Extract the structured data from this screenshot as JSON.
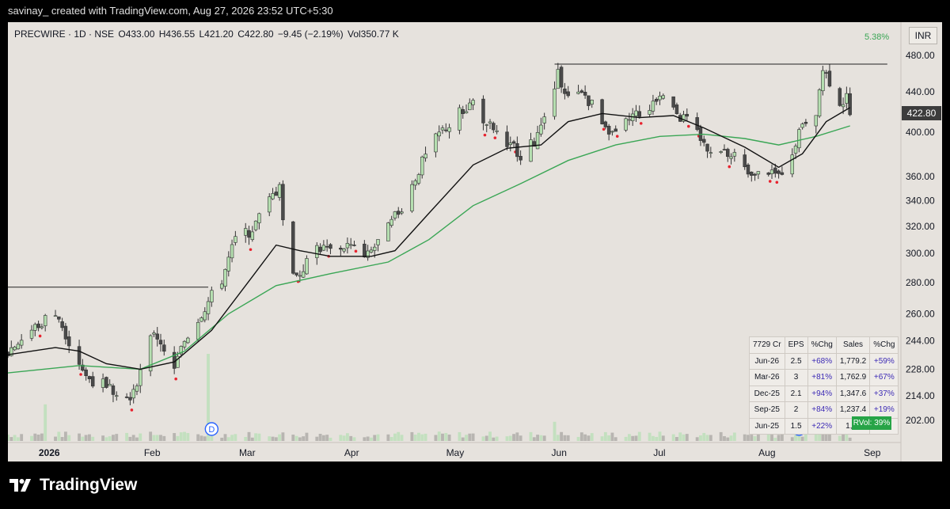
{
  "header": {
    "text": "savinay_ created with TradingView.com, Aug 27, 2026 23:52 UTC+5:30"
  },
  "legend": {
    "symbol": "PRECWIRE · 1D · NSE",
    "open": "O433.00",
    "high": "H436.55",
    "low": "L421.20",
    "close": "C422.80",
    "change": "−9.45 (−2.19%)",
    "volume": "Vol350.77 K"
  },
  "scale": {
    "currency": "INR",
    "percent_label": "5.38%",
    "last_price": "422.80"
  },
  "fundamentals": {
    "header": [
      "7729 Cr",
      "EPS",
      "%Chg",
      "Sales",
      "%Chg"
    ],
    "rows": [
      [
        "Jun-26",
        "2.5",
        "+68%",
        "1,779.2",
        "+59%"
      ],
      [
        "Mar-26",
        "3",
        "+81%",
        "1,762.9",
        "+67%"
      ],
      [
        "Dec-25",
        "2.1",
        "+94%",
        "1,347.6",
        "+37%"
      ],
      [
        "Sep-25",
        "2",
        "+84%",
        "1,237.4",
        "+19%"
      ],
      [
        "Jun-25",
        "1.5",
        "+22%",
        "1,11",
        ""
      ]
    ],
    "rvol": "RVol: 39%"
  },
  "brand": {
    "name": "TradingView"
  },
  "colors": {
    "up": "#b5dfb0",
    "down": "#4a4a4a",
    "ma_short": "#111111",
    "ma_long": "#3aa655",
    "marker": "#e8232f",
    "background": "#e6e2dd"
  },
  "icons": [
    "dividend-icon",
    "tradingview-logo-icon"
  ],
  "chart_data": {
    "type": "candlestick",
    "scale": "log",
    "ylim": [
      192,
      500
    ],
    "yticks": [
      202,
      214,
      228,
      244,
      260,
      280,
      300,
      320,
      340,
      360,
      400,
      440,
      480
    ],
    "xticks": [
      {
        "label": "2026",
        "date": "2026-01-01"
      },
      {
        "label": "Feb",
        "date": "2026-02-01"
      },
      {
        "label": "Mar",
        "date": "2026-03-01"
      },
      {
        "label": "Apr",
        "date": "2026-04-01"
      },
      {
        "label": "May",
        "date": "2026-05-01"
      },
      {
        "label": "Jun",
        "date": "2026-06-01"
      },
      {
        "label": "Jul",
        "date": "2026-07-01"
      },
      {
        "label": "Aug",
        "date": "2026-08-01"
      },
      {
        "label": "Sep",
        "date": "2026-09-01"
      }
    ],
    "xrange": [
      "2025-12-22",
      "2026-09-11"
    ],
    "close_path": [
      [
        "2025-12-22",
        238
      ],
      [
        "2025-12-29",
        250
      ],
      [
        "2026-01-05",
        262
      ],
      [
        "2026-01-09",
        244
      ],
      [
        "2026-01-14",
        224
      ],
      [
        "2026-01-20",
        219
      ],
      [
        "2026-01-27",
        215
      ],
      [
        "2026-01-30",
        226
      ],
      [
        "2026-02-03",
        250
      ],
      [
        "2026-02-06",
        240
      ],
      [
        "2026-02-09",
        228
      ],
      [
        "2026-02-12",
        244
      ],
      [
        "2026-02-18",
        264
      ],
      [
        "2026-02-23",
        282
      ],
      [
        "2026-02-27",
        310
      ],
      [
        "2026-03-04",
        318
      ],
      [
        "2026-03-09",
        340
      ],
      [
        "2026-03-12",
        352
      ],
      [
        "2026-03-14",
        290
      ],
      [
        "2026-03-18",
        286
      ],
      [
        "2026-03-23",
        305
      ],
      [
        "2026-03-27",
        302
      ],
      [
        "2026-04-01",
        306
      ],
      [
        "2026-04-07",
        298
      ],
      [
        "2026-04-13",
        318
      ],
      [
        "2026-04-18",
        340
      ],
      [
        "2026-04-23",
        372
      ],
      [
        "2026-04-28",
        398
      ],
      [
        "2026-05-04",
        418
      ],
      [
        "2026-05-08",
        430
      ],
      [
        "2026-05-12",
        408
      ],
      [
        "2026-05-18",
        392
      ],
      [
        "2026-05-22",
        380
      ],
      [
        "2026-05-26",
        390
      ],
      [
        "2026-05-29",
        412
      ],
      [
        "2026-06-02",
        458
      ],
      [
        "2026-06-05",
        438
      ],
      [
        "2026-06-10",
        436
      ],
      [
        "2026-06-15",
        412
      ],
      [
        "2026-06-19",
        396
      ],
      [
        "2026-06-24",
        416
      ],
      [
        "2026-06-29",
        425
      ],
      [
        "2026-07-02",
        440
      ],
      [
        "2026-07-06",
        420
      ],
      [
        "2026-07-10",
        410
      ],
      [
        "2026-07-15",
        388
      ],
      [
        "2026-07-20",
        382
      ],
      [
        "2026-07-24",
        376
      ],
      [
        "2026-07-29",
        358
      ],
      [
        "2026-08-03",
        366
      ],
      [
        "2026-08-06",
        360
      ],
      [
        "2026-08-10",
        384
      ],
      [
        "2026-08-13",
        410
      ],
      [
        "2026-08-17",
        420
      ],
      [
        "2026-08-19",
        464
      ],
      [
        "2026-08-21",
        452
      ],
      [
        "2026-08-24",
        430
      ],
      [
        "2026-08-26",
        432
      ],
      [
        "2026-08-27",
        422.8
      ]
    ],
    "ma_short": [
      [
        "2025-12-22",
        236
      ],
      [
        "2026-01-05",
        240
      ],
      [
        "2026-01-12",
        238
      ],
      [
        "2026-01-20",
        231
      ],
      [
        "2026-01-30",
        228
      ],
      [
        "2026-02-09",
        232
      ],
      [
        "2026-02-20",
        250
      ],
      [
        "2026-03-04",
        284
      ],
      [
        "2026-03-11",
        306
      ],
      [
        "2026-03-18",
        302
      ],
      [
        "2026-03-27",
        298
      ],
      [
        "2026-04-08",
        298
      ],
      [
        "2026-04-15",
        302
      ],
      [
        "2026-04-25",
        330
      ],
      [
        "2026-05-08",
        370
      ],
      [
        "2026-05-18",
        385
      ],
      [
        "2026-05-28",
        388
      ],
      [
        "2026-06-05",
        410
      ],
      [
        "2026-06-15",
        418
      ],
      [
        "2026-06-26",
        414
      ],
      [
        "2026-07-06",
        416
      ],
      [
        "2026-07-15",
        404
      ],
      [
        "2026-07-27",
        386
      ],
      [
        "2026-08-06",
        368
      ],
      [
        "2026-08-13",
        380
      ],
      [
        "2026-08-20",
        410
      ],
      [
        "2026-08-27",
        424
      ]
    ],
    "ma_long": [
      [
        "2025-12-22",
        226
      ],
      [
        "2026-01-12",
        230
      ],
      [
        "2026-01-30",
        228
      ],
      [
        "2026-02-12",
        238
      ],
      [
        "2026-02-25",
        260
      ],
      [
        "2026-03-11",
        278
      ],
      [
        "2026-03-27",
        286
      ],
      [
        "2026-04-13",
        294
      ],
      [
        "2026-04-25",
        310
      ],
      [
        "2026-05-08",
        336
      ],
      [
        "2026-05-22",
        354
      ],
      [
        "2026-06-05",
        374
      ],
      [
        "2026-06-19",
        388
      ],
      [
        "2026-07-02",
        396
      ],
      [
        "2026-07-15",
        398
      ],
      [
        "2026-07-27",
        394
      ],
      [
        "2026-08-06",
        388
      ],
      [
        "2026-08-17",
        396
      ],
      [
        "2026-08-27",
        406
      ]
    ],
    "resistance_lines": [
      {
        "from": "2025-12-22",
        "to": "2026-02-19",
        "price": 277
      },
      {
        "from": "2026-06-01",
        "to": "2026-09-07",
        "price": 470
      }
    ],
    "dividend_markers": [
      "2026-02-20",
      "2026-08-12"
    ],
    "volume_spikes": [
      {
        "date": "2026-02-19",
        "rel": 1.0
      },
      {
        "date": "2026-01-02",
        "rel": 0.42
      },
      {
        "date": "2026-06-01",
        "rel": 0.22
      },
      {
        "date": "2026-08-19",
        "rel": 0.28
      }
    ]
  }
}
